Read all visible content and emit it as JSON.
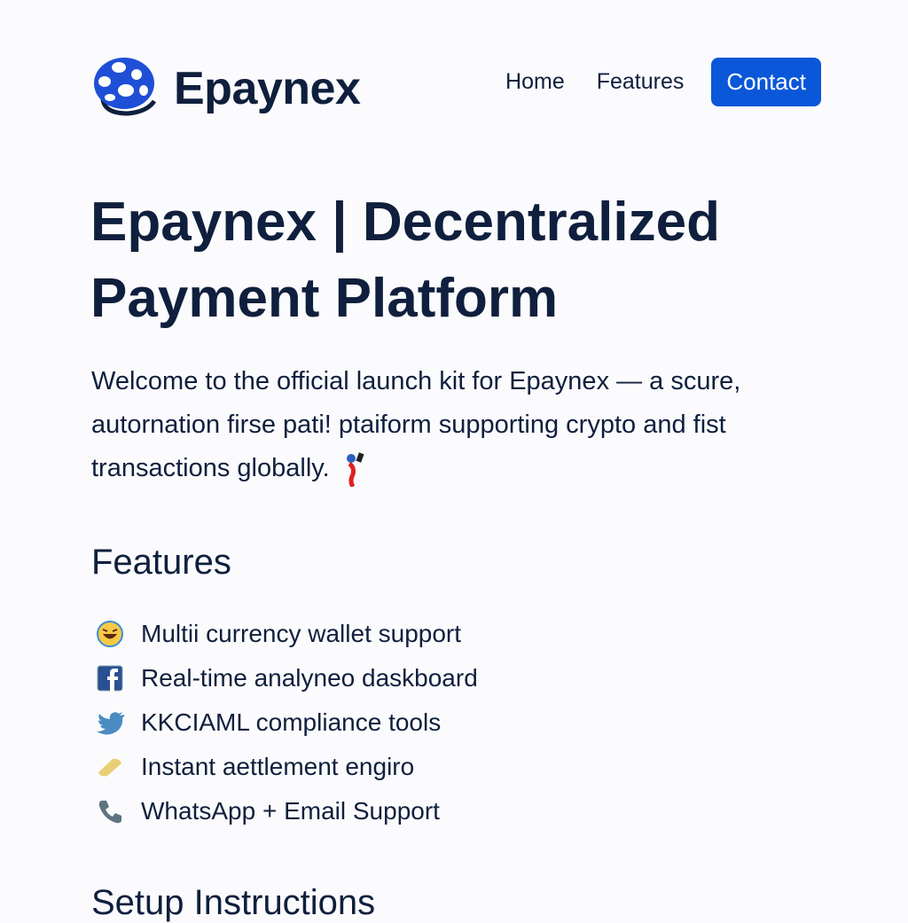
{
  "header": {
    "brand": "Epaynex",
    "nav": {
      "home": "Home",
      "features": "Features",
      "contact": "Contact"
    },
    "accent": "#0b57d9"
  },
  "hero": {
    "title": "Epaynex | Decentralized Payment Platform",
    "intro": "Welcome to the official launch kit for Epaynex — a scure, autornation firse pati! ptaiform supporting crypto and fist transactions globally.",
    "intro_emoji": "person-with-phone-emoji"
  },
  "features": {
    "heading": "Features",
    "items": [
      {
        "icon": "laughing-emoji-icon",
        "label": "Multii currency wallet support"
      },
      {
        "icon": "facebook-icon",
        "label": "Real-time analyneo daskboard"
      },
      {
        "icon": "twitter-bird-icon",
        "label": "KKCIAML compliance tools"
      },
      {
        "icon": "gold-bar-icon",
        "label": "Instant aettlement engiro"
      },
      {
        "icon": "phone-icon",
        "label": "WhatsApp + Email Support"
      }
    ]
  },
  "setup": {
    "heading": "Setup Instructions"
  }
}
